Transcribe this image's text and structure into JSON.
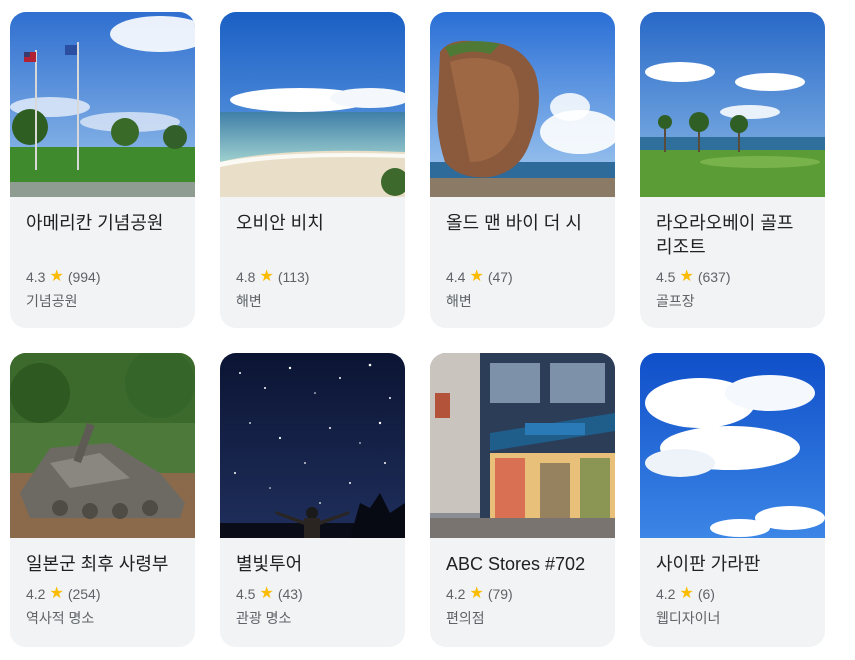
{
  "places": [
    {
      "title": "아메리칸 기념공원",
      "rating": "4.3",
      "reviews": "(994)",
      "category": "기념공원",
      "image": "memorial-park-photo"
    },
    {
      "title": "오비안 비치",
      "rating": "4.8",
      "reviews": "(113)",
      "category": "해변",
      "image": "beach-photo"
    },
    {
      "title": "올드 맨 바이 더 시",
      "rating": "4.4",
      "reviews": "(47)",
      "category": "해변",
      "image": "rock-formation-photo"
    },
    {
      "title": "라오라오베이 골프 리조트",
      "rating": "4.5",
      "reviews": "(637)",
      "category": "골프장",
      "image": "golf-course-photo"
    },
    {
      "title": "일본군 최후 사령부",
      "rating": "4.2",
      "reviews": "(254)",
      "category": "역사적 명소",
      "image": "tank-photo"
    },
    {
      "title": "별빛투어",
      "rating": "4.5",
      "reviews": "(43)",
      "category": "관광 명소",
      "image": "starry-sky-photo"
    },
    {
      "title": "ABC Stores #702",
      "rating": "4.2",
      "reviews": "(79)",
      "category": "편의점",
      "image": "store-photo"
    },
    {
      "title": "사이판 가라판",
      "rating": "4.2",
      "reviews": "(6)",
      "category": "웹디자이너",
      "image": "cloud-sky-photo"
    }
  ],
  "star_glyph": "★",
  "colors": {
    "star": "#fbbc04",
    "card_bg": "#f1f3f4",
    "title": "#202124",
    "meta": "#5f6368"
  }
}
